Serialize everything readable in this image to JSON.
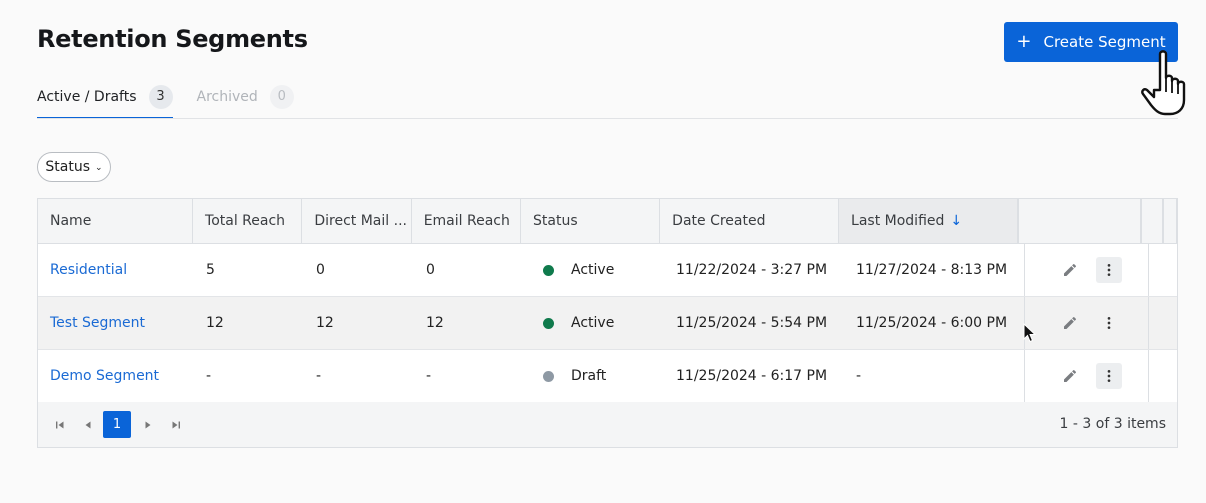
{
  "page": {
    "title": "Retention Segments"
  },
  "header": {
    "create_label": "Create Segment",
    "create_icon": "plus-icon"
  },
  "tabs": [
    {
      "label": "Active / Drafts",
      "count": "3",
      "active": true
    },
    {
      "label": "Archived",
      "count": "0",
      "active": false
    }
  ],
  "filters": {
    "status_label": "Status"
  },
  "table": {
    "columns": [
      "Name",
      "Total Reach",
      "Direct Mail ...",
      "Email Reach",
      "Status",
      "Date Created",
      "Last Modified"
    ],
    "sort_column": "Last Modified",
    "sort_direction": "descending",
    "rows": [
      {
        "name": "Residential",
        "total_reach": "5",
        "direct_mail": "0",
        "email_reach": "0",
        "status": "Active",
        "date_created": "11/22/2024 - 3:27 PM",
        "last_modified": "11/27/2024 - 8:13 PM"
      },
      {
        "name": "Test Segment",
        "total_reach": "12",
        "direct_mail": "12",
        "email_reach": "12",
        "status": "Active",
        "date_created": "11/25/2024 - 5:54 PM",
        "last_modified": "11/25/2024 - 6:00 PM"
      },
      {
        "name": "Demo Segment",
        "total_reach": "-",
        "direct_mail": "-",
        "email_reach": "-",
        "status": "Draft",
        "date_created": "11/25/2024 - 6:17 PM",
        "last_modified": "-"
      }
    ]
  },
  "pager": {
    "current_page": "1",
    "summary": "1 - 3 of 3 items"
  },
  "colors": {
    "accent": "#0a64d8",
    "active_status": "#0f7a4c",
    "draft_status": "#8e99a4",
    "link": "#1a6ad4"
  }
}
